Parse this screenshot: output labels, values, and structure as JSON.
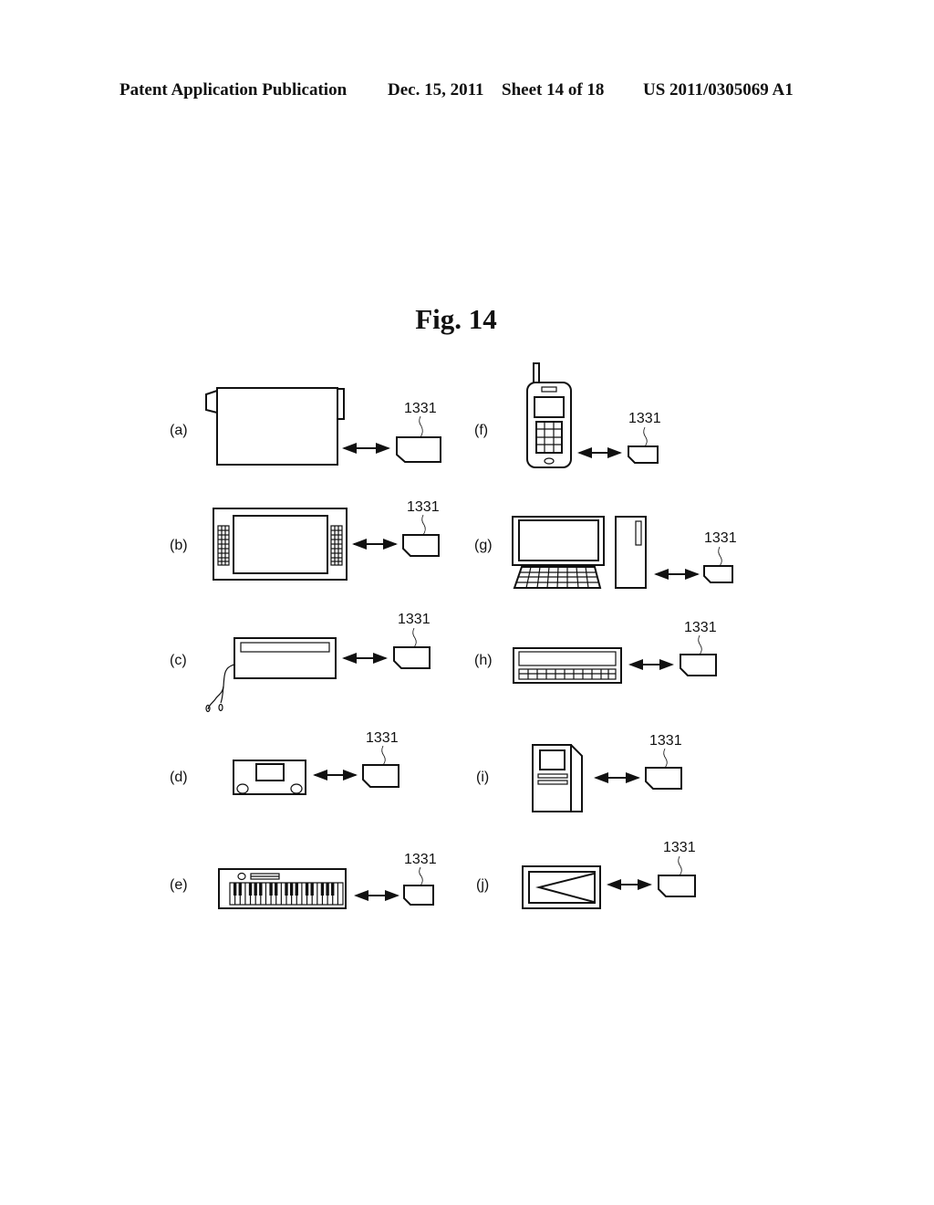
{
  "header": {
    "publication": "Patent Application Publication",
    "date": "Dec. 15, 2011",
    "sheet": "Sheet 14 of 18",
    "number": "US 2011/0305069 A1"
  },
  "figure": {
    "title": "Fig. 14",
    "panels": [
      {
        "label": "(a)",
        "device": "camcorder",
        "ref": "1331"
      },
      {
        "label": "(b)",
        "device": "portable-media-player",
        "ref": "1331"
      },
      {
        "label": "(c)",
        "device": "mp3-player-with-earphones",
        "ref": "1331"
      },
      {
        "label": "(d)",
        "device": "car-audio",
        "ref": "1331"
      },
      {
        "label": "(e)",
        "device": "electronic-keyboard",
        "ref": "1331"
      },
      {
        "label": "(f)",
        "device": "mobile-phone",
        "ref": "1331"
      },
      {
        "label": "(g)",
        "device": "desktop-computer",
        "ref": "1331"
      },
      {
        "label": "(h)",
        "device": "electronic-dictionary",
        "ref": "1331"
      },
      {
        "label": "(i)",
        "device": "kiosk-terminal",
        "ref": "1331"
      },
      {
        "label": "(j)",
        "device": "projector",
        "ref": "1331"
      }
    ]
  }
}
